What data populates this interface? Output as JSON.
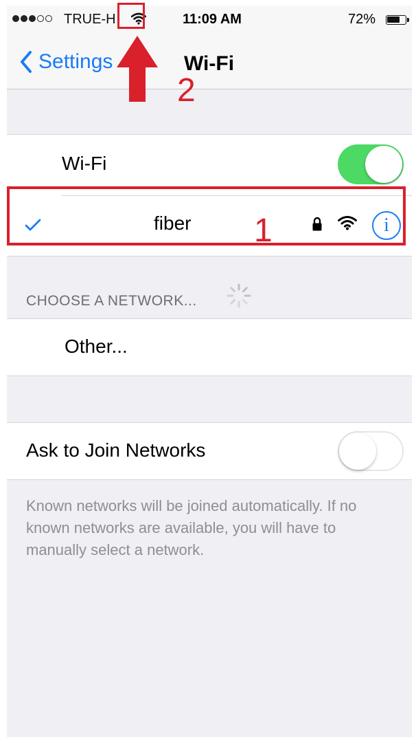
{
  "status_bar": {
    "signal_dots_filled": 3,
    "signal_dots_total": 5,
    "carrier": "TRUE-H",
    "wifi_icon": "wifi-icon",
    "time": "11:09 AM",
    "battery_percent": "72%",
    "battery_level": 0.72
  },
  "nav": {
    "back_label": "Settings",
    "title": "Wi-Fi"
  },
  "wifi": {
    "label": "Wi-Fi",
    "enabled": true
  },
  "connected_network": {
    "name": "fiber",
    "secured": true,
    "icons": [
      "checkmark-icon",
      "lock-icon",
      "wifi-signal-icon",
      "info-icon"
    ]
  },
  "choose_network": {
    "header": "CHOOSE A NETWORK...",
    "other_label": "Other..."
  },
  "ask_to_join": {
    "label": "Ask to Join Networks",
    "enabled": false,
    "footer": "Known networks will be joined automatically. If no known networks are available, you will have to manually select a network."
  },
  "annotations": {
    "box_1_number": "1",
    "box_2_number": "2",
    "color": "#d9202b"
  },
  "colors": {
    "accent": "#1a7cf5",
    "toggle_on": "#4cd964",
    "background": "#efeff4"
  }
}
